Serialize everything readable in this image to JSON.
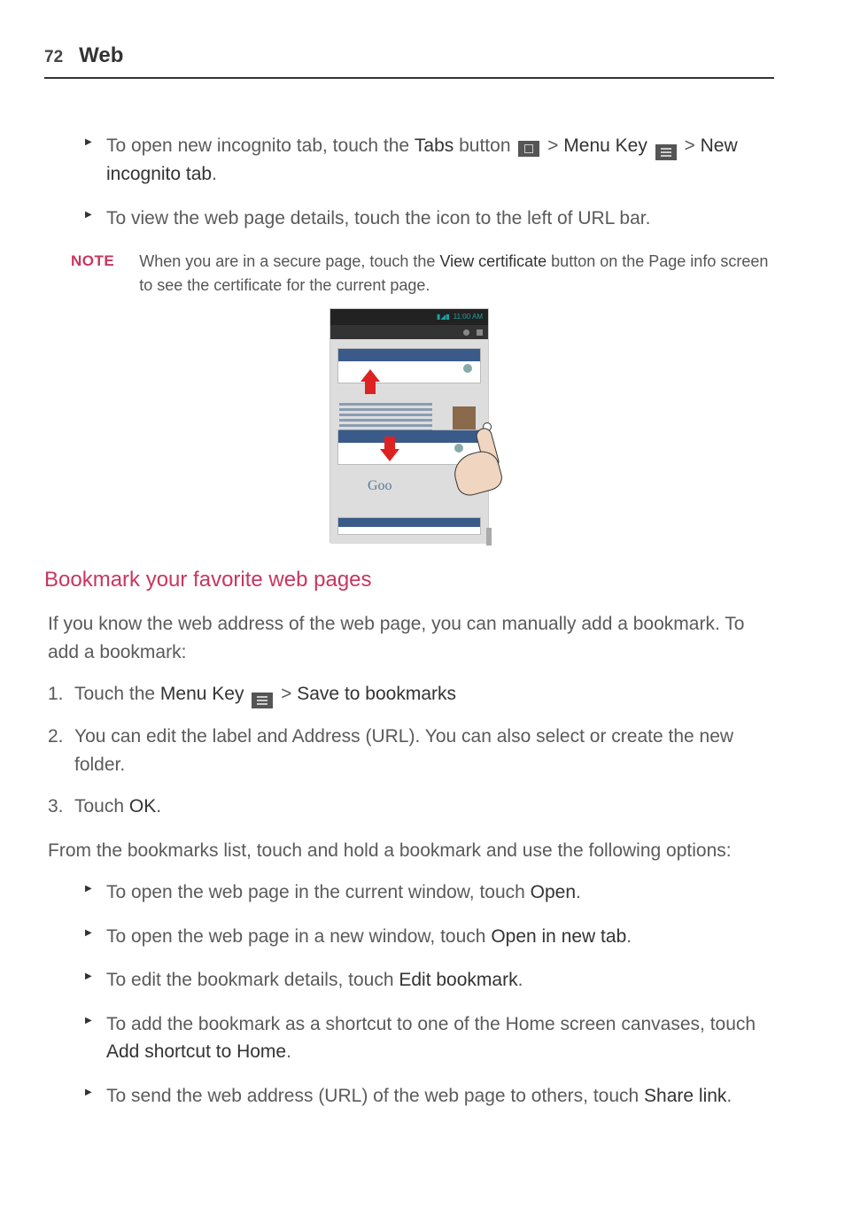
{
  "header": {
    "pageNumber": "72",
    "title": "Web"
  },
  "topBullets": [
    {
      "pre": "To open new incognito tab, touch the ",
      "b1": "Tabs",
      "mid1": " button ",
      "icon1": "tabs",
      "gt1": " > ",
      "b2": "Menu Key",
      "icon2": "menu",
      "gt2": " > ",
      "b3": "New incognito tab",
      "post": "."
    },
    {
      "text": "To view the web page details, touch the icon to the left of URL bar."
    }
  ],
  "note": {
    "label": "NOTE",
    "pre": "When you are in a secure page, touch the ",
    "b": "View certificate",
    "post": " button on the Page info screen to see the certificate for the current page."
  },
  "screenshot": {
    "time": "11:00 AM",
    "goText": "Goo"
  },
  "sectionHeading": "Bookmark your favorite web pages",
  "introPara": "If you know the web address of the web page, you can manually add a bookmark. To add a bookmark:",
  "steps": [
    {
      "num": "1.",
      "pre": "Touch the ",
      "b1": "Menu Key",
      "icon": "menu",
      "gt": " > ",
      "b2": "Save to bookmarks"
    },
    {
      "num": "2.",
      "text": "You can edit the  label and Address (URL). You can also select or create the new folder."
    },
    {
      "num": "3.",
      "pre": "Touch ",
      "b1": "OK",
      "post": "."
    }
  ],
  "afterSteps": "From the bookmarks list, touch and hold a bookmark and use the following options:",
  "optionBullets": [
    {
      "pre": "To open the web page in the current window, touch ",
      "b": "Open",
      "post": "."
    },
    {
      "pre": "To open the web page in a new window, touch ",
      "b": "Open in new tab",
      "post": "."
    },
    {
      "pre": "To edit the bookmark details, touch ",
      "b": "Edit bookmark",
      "post": "."
    },
    {
      "pre": "To add the bookmark as a shortcut to one of the Home screen canvases, touch ",
      "b": "Add shortcut to Home",
      "post": "."
    },
    {
      "pre": "To send the web address (URL) of the web page to others, touch ",
      "b": "Share link",
      "post": "."
    }
  ]
}
